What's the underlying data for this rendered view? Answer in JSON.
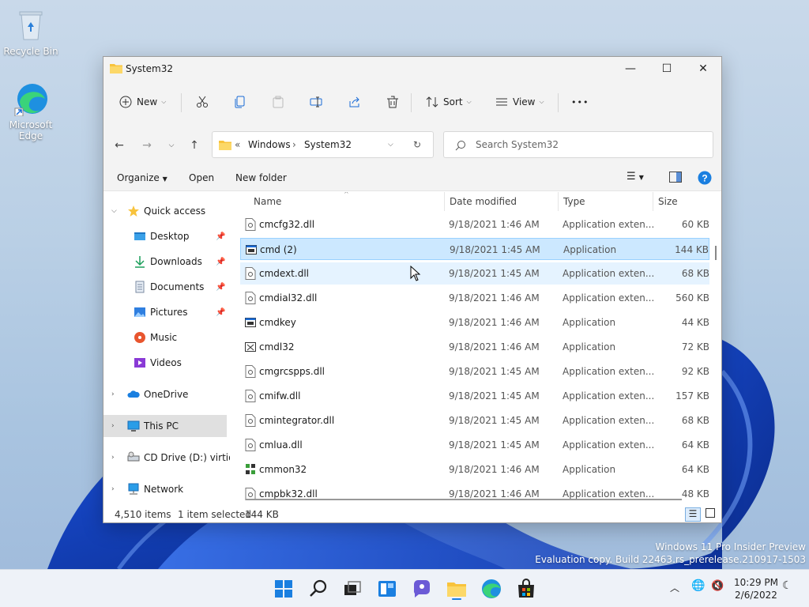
{
  "desktop": {
    "icons": [
      {
        "label": "Recycle Bin"
      },
      {
        "label": "Microsoft Edge"
      }
    ]
  },
  "window": {
    "title": "System32",
    "controls": {
      "minimize": "—",
      "maximize": "☐",
      "close": "✕"
    },
    "toolbar": {
      "new_label": "New",
      "sort_label": "Sort",
      "view_label": "View",
      "more_label": "•••"
    },
    "address": {
      "overflow": "«",
      "crumbs": [
        "Windows",
        "System32"
      ]
    },
    "search": {
      "placeholder": "Search System32"
    },
    "menu": {
      "organize": "Organize",
      "open": "Open",
      "new_folder": "New folder"
    },
    "nav": {
      "quick_access": "Quick access",
      "items": [
        {
          "label": "Desktop"
        },
        {
          "label": "Downloads"
        },
        {
          "label": "Documents"
        },
        {
          "label": "Pictures"
        },
        {
          "label": "Music"
        },
        {
          "label": "Videos"
        }
      ],
      "onedrive": "OneDrive",
      "this_pc": "This PC",
      "cd_drive": "CD Drive (D:) virtio-w",
      "network": "Network"
    },
    "columns": {
      "name": "Name",
      "date": "Date modified",
      "type": "Type",
      "size": "Size"
    },
    "files": [
      {
        "name": "cmcfg32.dll",
        "date": "9/18/2021 1:46 AM",
        "type": "Application exten...",
        "size": "60 KB",
        "icon": "dll"
      },
      {
        "name": "cmd (2)",
        "date": "9/18/2021 1:45 AM",
        "type": "Application",
        "size": "144 KB",
        "icon": "app"
      },
      {
        "name": "cmdext.dll",
        "date": "9/18/2021 1:45 AM",
        "type": "Application exten...",
        "size": "68 KB",
        "icon": "dll"
      },
      {
        "name": "cmdial32.dll",
        "date": "9/18/2021 1:46 AM",
        "type": "Application exten...",
        "size": "560 KB",
        "icon": "dll"
      },
      {
        "name": "cmdkey",
        "date": "9/18/2021 1:46 AM",
        "type": "Application",
        "size": "44 KB",
        "icon": "app"
      },
      {
        "name": "cmdl32",
        "date": "9/18/2021 1:46 AM",
        "type": "Application",
        "size": "72 KB",
        "icon": "phone"
      },
      {
        "name": "cmgrcspps.dll",
        "date": "9/18/2021 1:45 AM",
        "type": "Application exten...",
        "size": "92 KB",
        "icon": "dll"
      },
      {
        "name": "cmifw.dll",
        "date": "9/18/2021 1:45 AM",
        "type": "Application exten...",
        "size": "157 KB",
        "icon": "dll"
      },
      {
        "name": "cmintegrator.dll",
        "date": "9/18/2021 1:45 AM",
        "type": "Application exten...",
        "size": "68 KB",
        "icon": "dll"
      },
      {
        "name": "cmlua.dll",
        "date": "9/18/2021 1:45 AM",
        "type": "Application exten...",
        "size": "64 KB",
        "icon": "dll"
      },
      {
        "name": "cmmon32",
        "date": "9/18/2021 1:46 AM",
        "type": "Application",
        "size": "64 KB",
        "icon": "mon"
      },
      {
        "name": "cmpbk32.dll",
        "date": "9/18/2021 1:46 AM",
        "type": "Application exten...",
        "size": "48 KB",
        "icon": "dll"
      }
    ],
    "status": {
      "count": "4,510 items",
      "selected": "1 item selected",
      "size": "144 KB"
    }
  },
  "watermark": {
    "line1": "Windows 11 Pro Insider Preview",
    "line2": "Evaluation copy. Build 22463.rs_prerelease.210917-1503"
  },
  "taskbar": {
    "time": "10:29 PM",
    "date": "2/6/2022"
  },
  "colors": {
    "accent": "#0067c0",
    "selection": "#cce8ff",
    "folder": "#f8c33c"
  }
}
